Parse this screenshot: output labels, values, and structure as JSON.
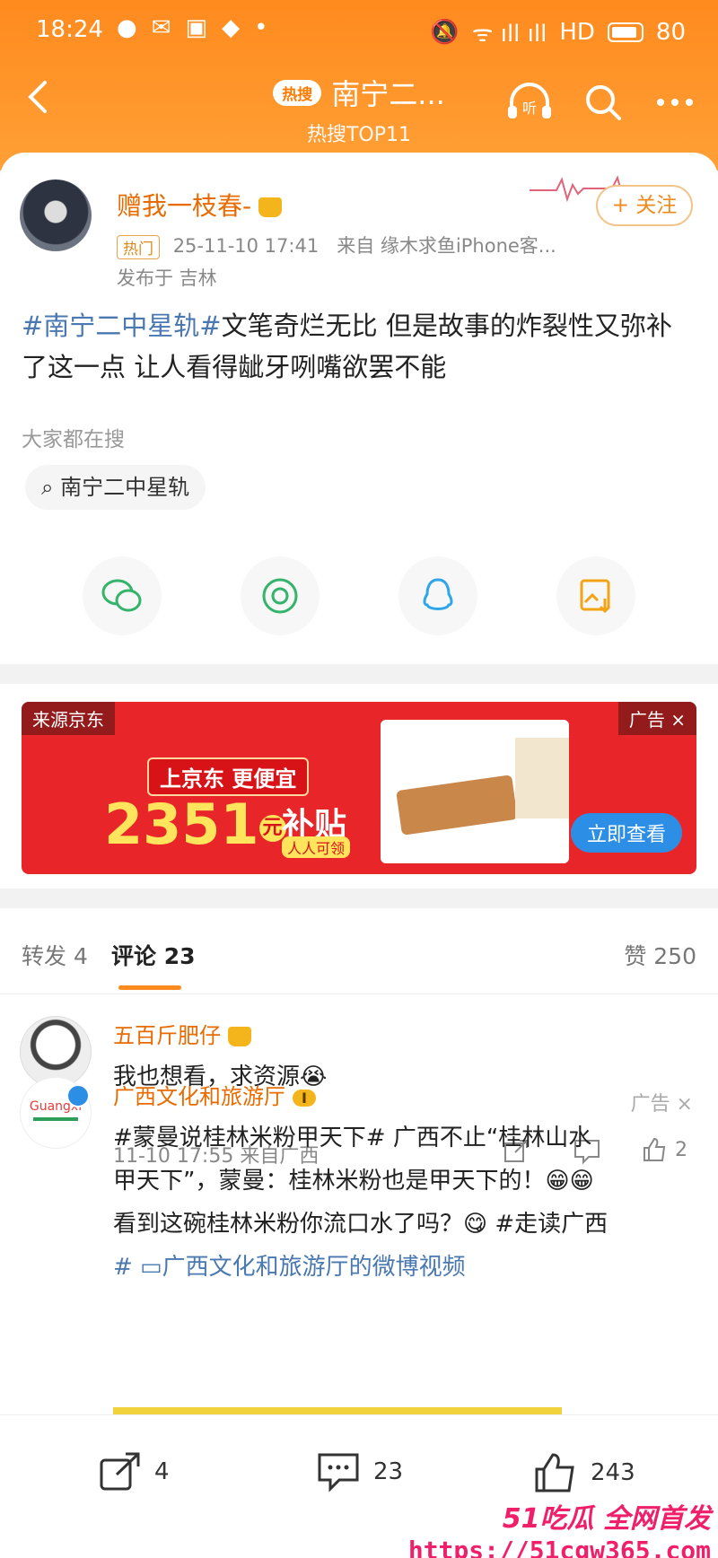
{
  "status_bar": {
    "time": "18:24",
    "signal": "ᯤ ıll ıll",
    "hd": "HD",
    "battery": "80"
  },
  "nav": {
    "hot_chip": "热搜",
    "title": "南宁二...",
    "subtitle": "热搜TOP11",
    "listen": "听"
  },
  "post": {
    "username": "赠我一枝春-",
    "tag_hot": "热门",
    "datetime": "25-11-10 17:41",
    "source": "来自 缘木求鱼iPhone客...",
    "location": "发布于 吉林",
    "follow_label": "+ 关注",
    "hashtag": "#南宁二中星轨#",
    "body": "文笔奇烂无比 但是故事的炸裂性又弥补了这一点 让人看得龇牙咧嘴欲罢不能",
    "search_label": "大家都在搜",
    "search_chip": "南宁二中星轨"
  },
  "ad": {
    "source": "来源京东",
    "close": "广告 ×",
    "slogan": "上京东 更便宜",
    "amount": "2351",
    "unit": "元",
    "subsidy": "补贴",
    "subsidy_sub": "人人可领",
    "cta": "立即查看"
  },
  "tabs": {
    "repost": "转发 4",
    "comments": "评论 23",
    "likes": "赞 250"
  },
  "comments": [
    {
      "name": "五百斤肥仔",
      "text": "我也想看，求资源😭",
      "meta": "11-10 17:55 来自广西",
      "likes": "2"
    },
    {
      "name": "广西文化和旅游厅",
      "level": "I",
      "ad_tag": "广告 ×",
      "line1": "#蒙曼说桂林米粉甲天下# 广西不止“桂林山水",
      "line2": "甲天下”，蒙曼：桂林米粉也是甲天下的！😁😁",
      "line3": "看到这碗桂林米粉你流口水了吗？😋 #走读广西",
      "line4": "#    ▭广西文化和旅游厅的微博视频"
    }
  ],
  "bottom": {
    "reposts": "4",
    "comments": "23",
    "likes": "243"
  },
  "watermark": {
    "line1": "51吃瓜 全网首发",
    "line2": "https://51cgw365.com"
  },
  "colors": {
    "accent": "#ff8a1e",
    "link": "#4a78b0",
    "name": "#e86b00",
    "ad_bg": "#e8262a"
  }
}
